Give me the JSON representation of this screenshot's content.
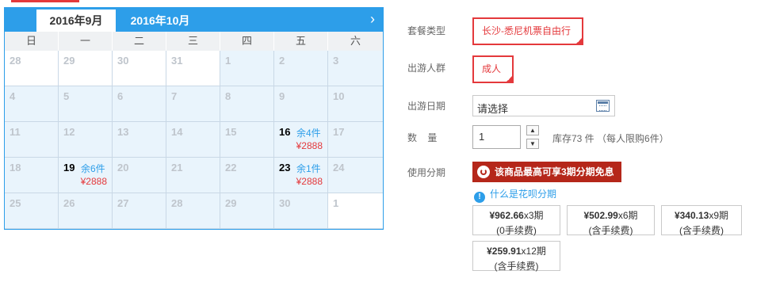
{
  "calendar": {
    "active_month": "2016年9月",
    "next_month": "2016年10月",
    "next_arrow": "›",
    "weekdays": [
      "日",
      "一",
      "二",
      "三",
      "四",
      "五",
      "六"
    ],
    "days": [
      {
        "n": "28",
        "out": true
      },
      {
        "n": "29",
        "out": true
      },
      {
        "n": "30",
        "out": true
      },
      {
        "n": "31",
        "out": true
      },
      {
        "n": "1"
      },
      {
        "n": "2"
      },
      {
        "n": "3"
      },
      {
        "n": "4"
      },
      {
        "n": "5"
      },
      {
        "n": "6"
      },
      {
        "n": "7"
      },
      {
        "n": "8"
      },
      {
        "n": "9"
      },
      {
        "n": "10"
      },
      {
        "n": "11"
      },
      {
        "n": "12"
      },
      {
        "n": "13"
      },
      {
        "n": "14"
      },
      {
        "n": "15"
      },
      {
        "n": "16",
        "stock": "余4件",
        "price": "¥2888"
      },
      {
        "n": "17"
      },
      {
        "n": "18"
      },
      {
        "n": "19",
        "stock": "余6件",
        "price": "¥2888"
      },
      {
        "n": "20"
      },
      {
        "n": "21"
      },
      {
        "n": "22"
      },
      {
        "n": "23",
        "stock": "余1件",
        "price": "¥2888"
      },
      {
        "n": "24"
      },
      {
        "n": "25"
      },
      {
        "n": "26"
      },
      {
        "n": "27"
      },
      {
        "n": "28"
      },
      {
        "n": "29"
      },
      {
        "n": "30"
      },
      {
        "n": "1",
        "out": true
      }
    ]
  },
  "form": {
    "package_label": "套餐类型",
    "package_value": "长沙-悉尼机票自由行",
    "people_label": "出游人群",
    "people_value": "成人",
    "date_label": "出游日期",
    "date_value": "请选择",
    "quantity_label": "数    量",
    "quantity_value": "1",
    "stepper_up": "▲",
    "stepper_down": "▼",
    "stock_info": "库存73 件 （每人限购6件）",
    "installment_label": "使用分期",
    "promo_text": "该商品最高可享3期分期免息",
    "help_icon": "!",
    "help_text": "什么是花呗分期"
  },
  "plans": [
    {
      "amount": "¥962.66",
      "term": "x3期",
      "fee": "(0手续费)"
    },
    {
      "amount": "¥502.99",
      "term": "x6期",
      "fee": "(含手续费)"
    },
    {
      "amount": "¥340.13",
      "term": "x9期",
      "fee": "(含手续费)"
    },
    {
      "amount": "¥259.91",
      "term": "x12期",
      "fee": "(含手续费)"
    }
  ],
  "colors": {
    "accent_red": "#e4393c",
    "calendar_blue": "#2d9ee9",
    "promo_red": "#b5271a"
  }
}
